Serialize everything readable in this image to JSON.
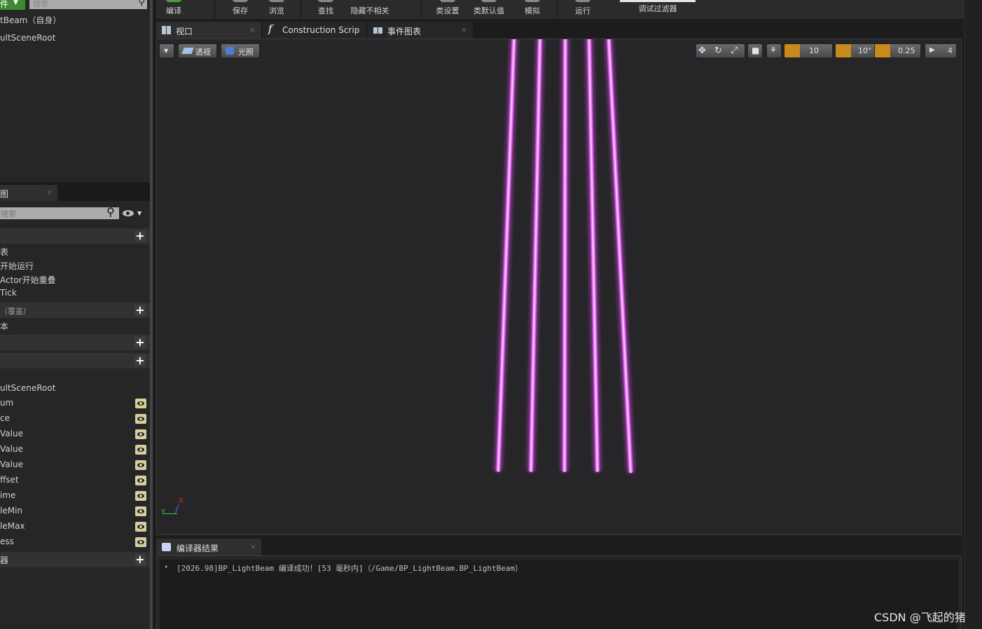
{
  "toolbar": {
    "compile": "编译",
    "save": "保存",
    "browse": "浏览",
    "find": "查找",
    "hide_unrelated": "隐藏不相关",
    "class_settings": "类设置",
    "class_defaults": "类默认值",
    "simulate": "模拟",
    "play": "运行",
    "debug_filter": "调试过滤器"
  },
  "components": {
    "dropdown_label": "件",
    "search_placeholder": "搜索",
    "self_item": "tBeam（自身）",
    "root_item": "ultSceneRoot"
  },
  "my_blueprint": {
    "tab_label": "图",
    "search_placeholder": "搜索",
    "graph_items": [
      "表",
      "开始运行",
      "Actor开始重叠",
      "Tick"
    ],
    "override_label": "（覆盖）",
    "doc_item": "本",
    "variables_root": "ultSceneRoot",
    "variables": [
      "um",
      "ce",
      "Value",
      "Value",
      "Value",
      "ffset",
      "ime",
      "leMin",
      "leMax",
      "ess"
    ],
    "dispatchers_label": "器"
  },
  "tabs": {
    "viewport": "视口",
    "construction": "Construction Scrip",
    "event_graph": "事件图表",
    "compiler": "编译器结果"
  },
  "viewport": {
    "perspective": "透视",
    "lit": "光照",
    "grid_snap": "10",
    "rotation_snap": "10°",
    "scale_snap": "0.25",
    "camera_speed": "4",
    "axis_x": "X",
    "axis_y": "Y"
  },
  "compiler": {
    "message": "[2026.98]BP_LightBeam 编译成功！[53 毫秒内]（/Game/BP_LightBeam.BP_LightBeam）"
  },
  "watermark": "CSDN @飞起的猪",
  "colors": {
    "beam": "#d04ce0",
    "accent_orange": "#c78a1c",
    "eye": "#d6cf9c"
  }
}
